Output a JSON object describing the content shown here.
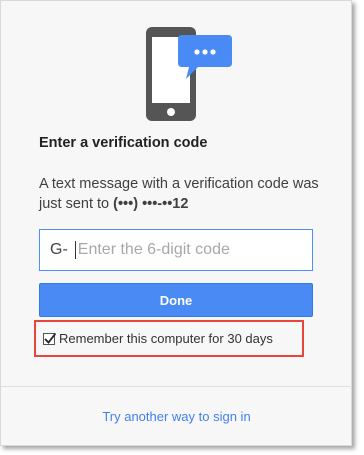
{
  "verification": {
    "title": "Enter a verification code",
    "message_prefix": "A text message with a verification code was just sent to ",
    "phone_masked": "(•••) •••-••12",
    "code_prefix": "G-",
    "code_placeholder": "Enter the 6-digit code",
    "code_value": "",
    "done_label": "Done",
    "remember_label": "Remember this computer for 30 days",
    "remember_checked": true,
    "alternate_link": "Try another way to sign in"
  },
  "icons": {
    "illustration": "phone-with-message-bubble-icon",
    "checkbox_mark": "checkmark-icon"
  },
  "colors": {
    "primary_button": "#4a8af4",
    "link": "#427fed",
    "highlight_box": "#e8463d",
    "input_focus_border": "#4d90fe",
    "phone_body": "#555555",
    "message_bubble": "#4a8af4"
  }
}
